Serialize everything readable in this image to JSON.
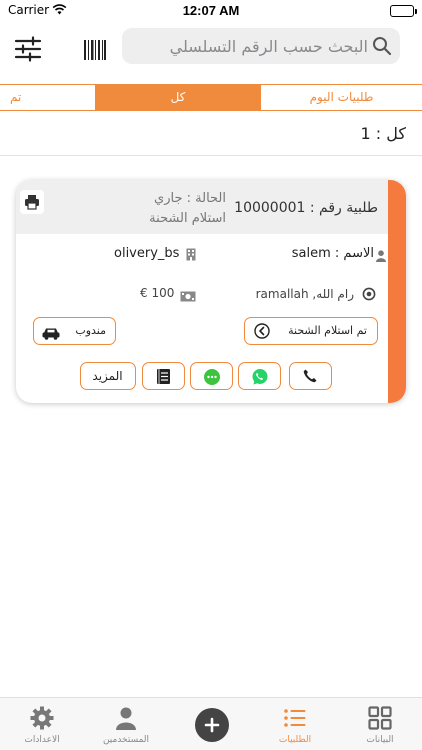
{
  "status_bar": {
    "carrier": "Carrier",
    "time": "12:07 AM"
  },
  "search": {
    "placeholder": "البحث حسب الرقم التسلسلي"
  },
  "tabs": [
    {
      "label": "تم",
      "selected": false
    },
    {
      "label": "كل",
      "selected": true
    },
    {
      "label": "طلبيات اليوم",
      "selected": false
    }
  ],
  "count_label": "كل : 1",
  "order": {
    "number_label": "طلبية رقم : 10000001",
    "status_label": "الحالة : جاري استلام الشحنة",
    "customer_label": "الاسم : salem",
    "store": "olivery_bs",
    "address": "رام الله, ramallah",
    "price": "€ 100",
    "received_button": "تم استلام الشحنة",
    "driver_button": "مندوب",
    "more_button": "المزيد"
  },
  "colors": {
    "accent": "#f08a3c",
    "card_stripe": "#f57a3d",
    "whatsapp": "#25d366",
    "chat": "#3cc43c"
  },
  "tab_bar": [
    {
      "label": "الاعدادات",
      "icon": "gear-icon"
    },
    {
      "label": "المستخدمين",
      "icon": "user-icon"
    },
    {
      "label": "",
      "icon": "plus-icon"
    },
    {
      "label": "الطلبيات",
      "icon": "list-icon",
      "active": true
    },
    {
      "label": "البيانات",
      "icon": "grid-icon"
    }
  ]
}
